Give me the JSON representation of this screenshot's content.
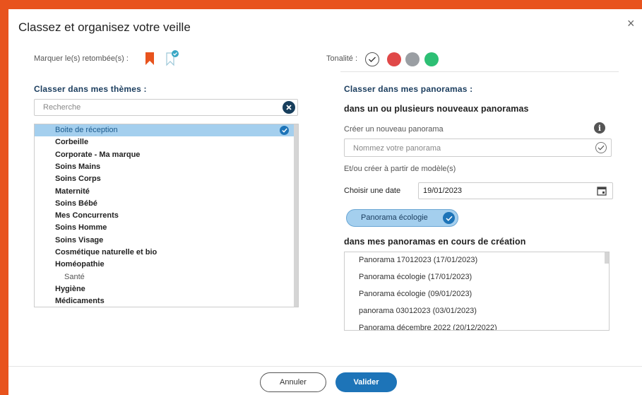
{
  "dialog": {
    "title": "Classez et organisez votre veille",
    "close_icon": "×"
  },
  "marking": {
    "label": "Marquer le(s) retombée(s) :"
  },
  "tonality": {
    "label": "Tonalité :",
    "colors": {
      "negative": "#e04848",
      "neutral": "#9a9ea3",
      "positive": "#2dbf74"
    }
  },
  "themes": {
    "title": "Classer dans mes thèmes :",
    "search_placeholder": "Recherche",
    "items": [
      {
        "label": "Boite de réception",
        "selected": true
      },
      {
        "label": "Corbeille"
      },
      {
        "label": "Corporate - Ma marque"
      },
      {
        "label": "Soins Mains"
      },
      {
        "label": "Soins Corps"
      },
      {
        "label": "Maternité"
      },
      {
        "label": "Soins Bébé"
      },
      {
        "label": "Mes Concurrents"
      },
      {
        "label": "Soins Homme"
      },
      {
        "label": "Soins Visage"
      },
      {
        "label": "Cosmétique naturelle et bio"
      },
      {
        "label": "Homéopathie"
      },
      {
        "label": "Santé",
        "child": true
      },
      {
        "label": "Hygiène"
      },
      {
        "label": "Médicaments"
      }
    ]
  },
  "panoramas": {
    "title": "Classer dans mes panoramas :",
    "new_section_title": "dans un ou plusieurs nouveaux panoramas",
    "create_label": "Créer un nouveau panorama",
    "name_placeholder": "Nommez votre panorama",
    "template_label": "Et/ou créer à partir de modèle(s)",
    "date_label": "Choisir une date",
    "date_value": "19/01/2023",
    "selected_chip": "Panorama écologie",
    "existing_section_title": "dans mes panoramas en cours de création",
    "existing": [
      "Panorama 17012023 (17/01/2023)",
      "Panorama écologie (17/01/2023)",
      "Panorama écologie (09/01/2023)",
      "panorama 03012023 (03/01/2023)",
      "Panorama décembre 2022 (20/12/2022)"
    ]
  },
  "footer": {
    "cancel_label": "Annuler",
    "validate_label": "Valider"
  }
}
